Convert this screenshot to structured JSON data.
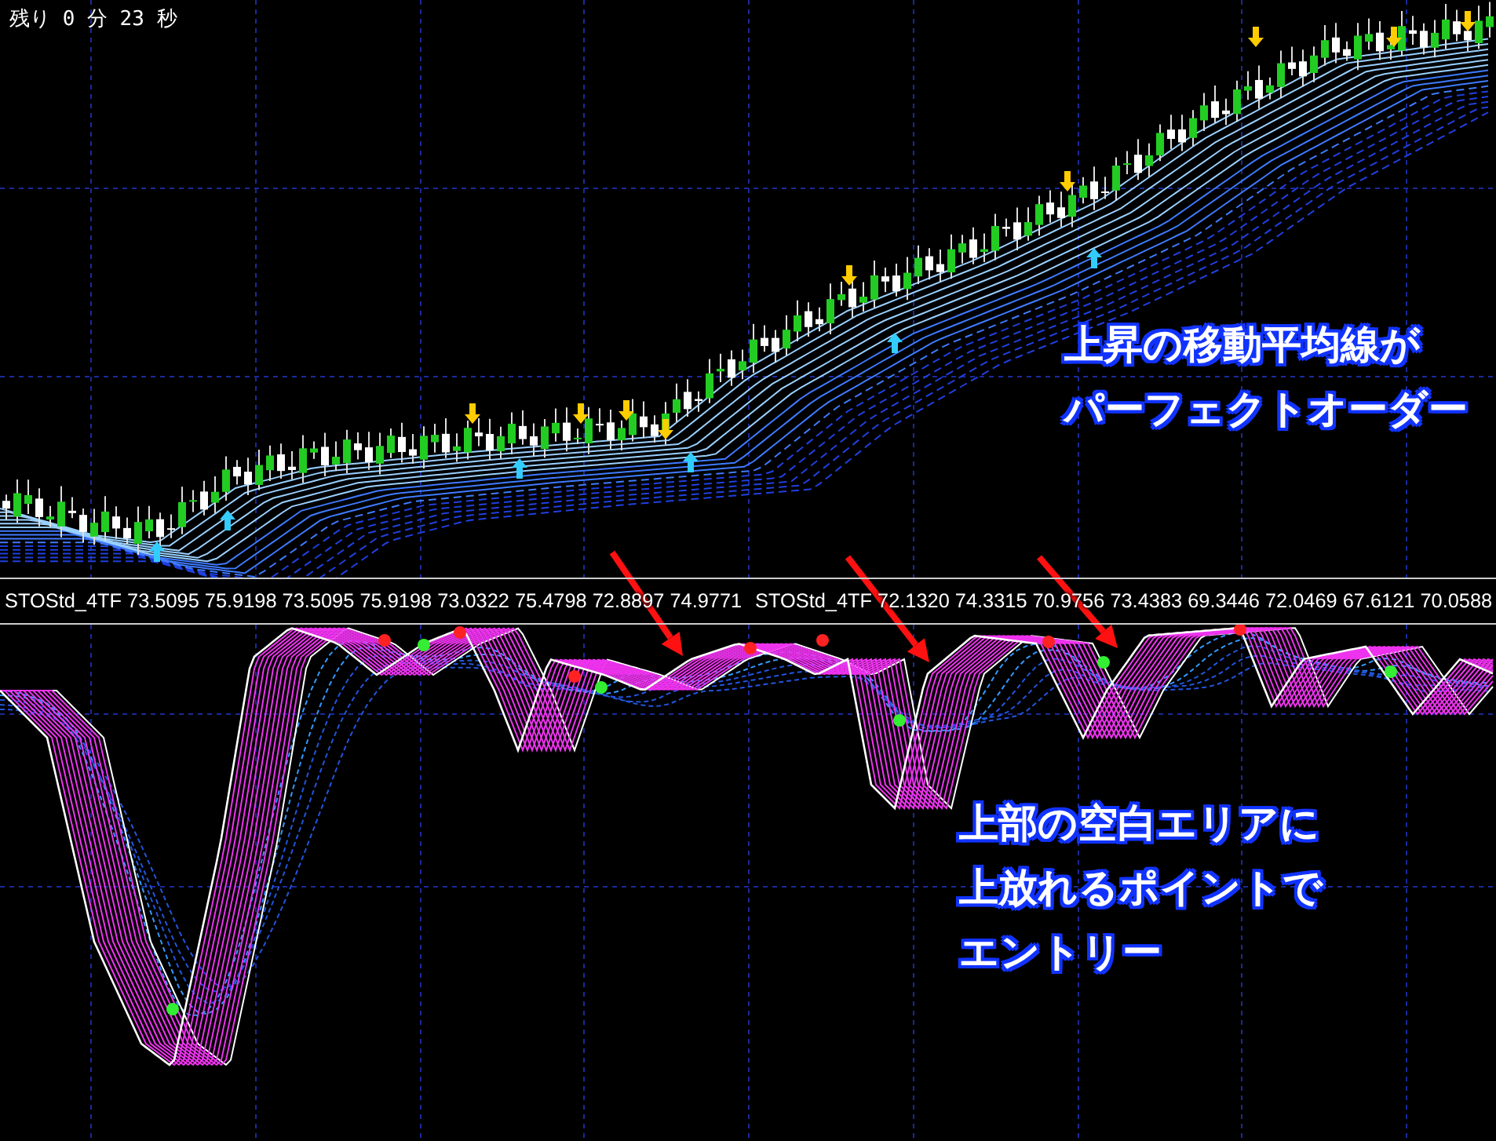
{
  "timer": {
    "text": "残り 0 分 23 秒"
  },
  "price_chart": {
    "annotation_lines": [
      "上昇の移動平均線が",
      "パーフェクトオーダー"
    ]
  },
  "indicator_label": {
    "readouts": [
      "STOStd_4TF 73.5095 75.9198 73.5095 75.9198 73.0322 75.4798 72.8897 74.9771",
      "STOStd_4TF 72.1320 74.3315 70.9756 73.4383 69.3446 72.0469 67.6121 70.0588"
    ]
  },
  "oscillator_chart": {
    "annotation_lines": [
      "上部の空白エリアに",
      "上放れるポイントで",
      "エントリー"
    ]
  }
}
